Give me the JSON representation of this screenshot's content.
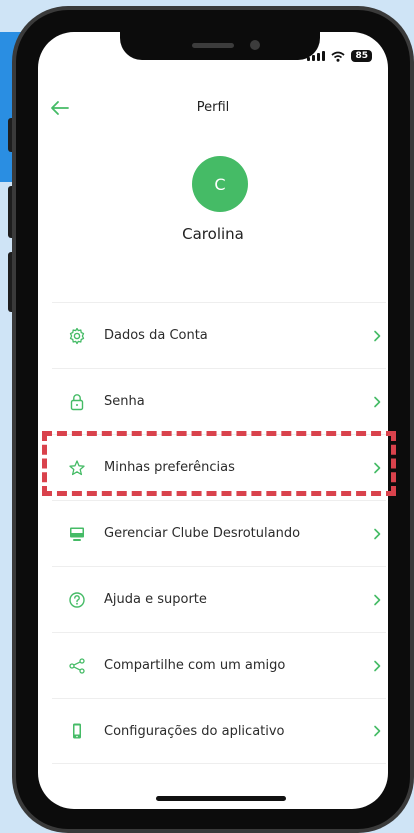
{
  "status": {
    "battery": "85"
  },
  "header": {
    "title": "Perfil"
  },
  "profile": {
    "initial": "C",
    "name": "Carolina"
  },
  "menu": [
    {
      "icon": "gear-icon",
      "label": "Dados da Conta"
    },
    {
      "icon": "lock-icon",
      "label": "Senha"
    },
    {
      "icon": "star-icon",
      "label": "Minhas preferências"
    },
    {
      "icon": "monitor-icon",
      "label": "Gerenciar Clube Desrotulando"
    },
    {
      "icon": "help-circle-icon",
      "label": "Ajuda e suporte"
    },
    {
      "icon": "share-icon",
      "label": "Compartilhe com um amigo"
    },
    {
      "icon": "smartphone-icon",
      "label": "Configurações do aplicativo"
    }
  ],
  "colors": {
    "accent": "#45bb66",
    "highlight": "#d9424c"
  }
}
